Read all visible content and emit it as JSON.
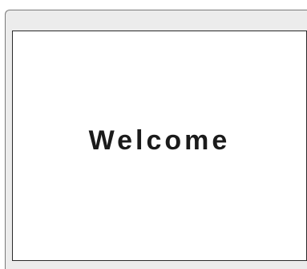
{
  "window": {
    "content": {
      "heading": "Welcome"
    }
  },
  "colors": {
    "window_background": "#ececec",
    "panel_background": "#ffffff",
    "border": "#2a2a2a",
    "text": "#1b1b1b"
  }
}
